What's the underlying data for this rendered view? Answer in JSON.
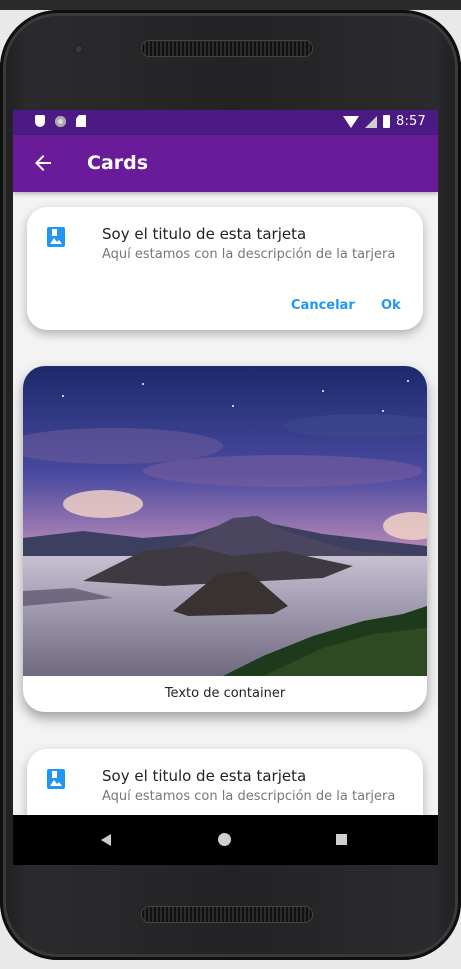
{
  "status_bar": {
    "time": "8:57",
    "icons": [
      "shield-icon",
      "circle-icon",
      "sd-card-icon",
      "wifi-icon",
      "cell-signal-icon",
      "battery-icon"
    ]
  },
  "app_bar": {
    "title": "Cards",
    "back_icon": "arrow-back-icon",
    "color": "#6a1b9a"
  },
  "cards": [
    {
      "icon": "photo-album-icon",
      "title": "Soy el titulo de esta tarjeta",
      "subtitle": "Aquí estamos con la descripción de la tarjera",
      "actions": [
        "Cancelar",
        "Ok"
      ]
    },
    {
      "image": "volcano-landscape",
      "caption": "Texto de container"
    },
    {
      "icon": "photo-album-icon",
      "title": "Soy el titulo de esta tarjeta",
      "subtitle": "Aquí estamos con la descripción de la tarjera"
    }
  ],
  "nav_bar": {
    "icons": [
      "back-triangle-icon",
      "home-circle-icon",
      "recents-square-icon"
    ]
  },
  "colors": {
    "status_bar": "#4b1a85",
    "accent": "#2196f3"
  }
}
